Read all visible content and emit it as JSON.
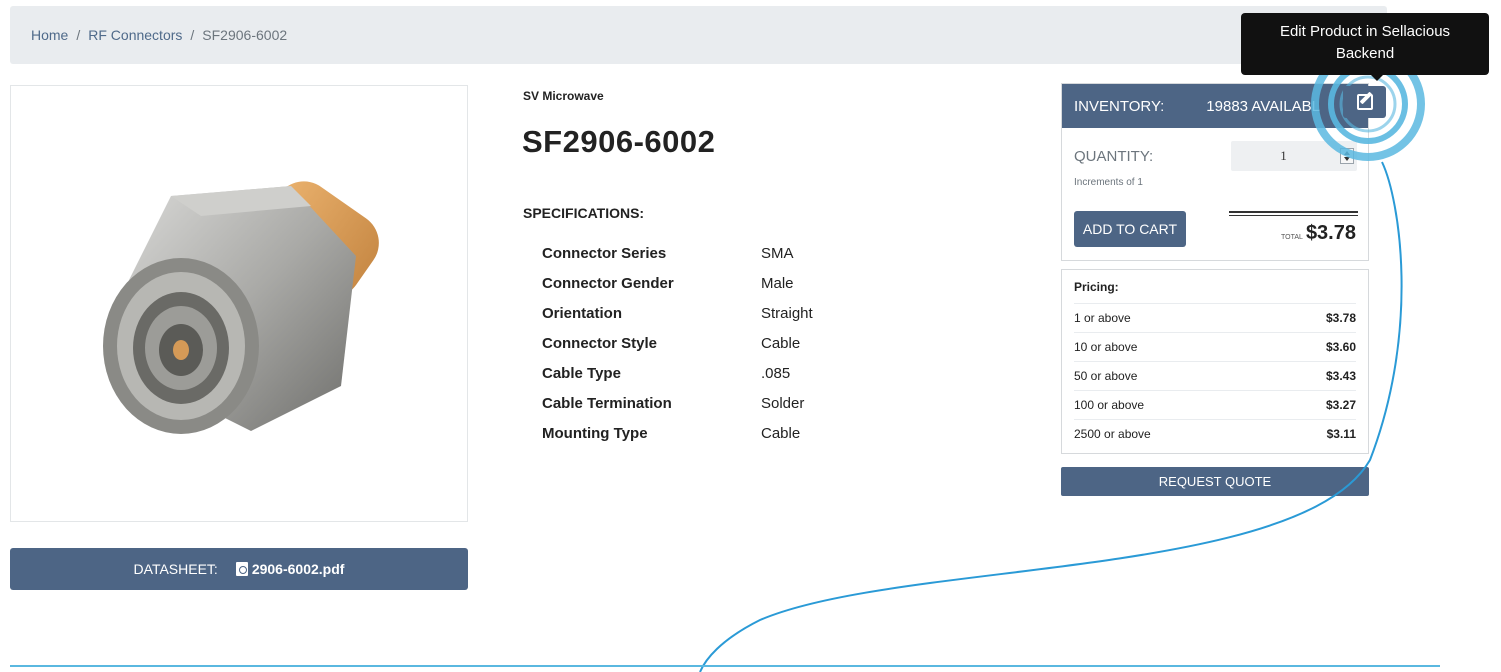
{
  "breadcrumb": {
    "home": "Home",
    "category": "RF Connectors",
    "current": "SF2906-6002",
    "separator": "/"
  },
  "product": {
    "brand": "SV Microwave",
    "title": "SF2906-6002",
    "spec_heading": "SPECIFICATIONS:",
    "specs": [
      {
        "key": "Connector Series",
        "value": "SMA"
      },
      {
        "key": "Connector Gender",
        "value": "Male"
      },
      {
        "key": "Orientation",
        "value": "Straight"
      },
      {
        "key": "Connector Style",
        "value": "Cable"
      },
      {
        "key": "Cable Type",
        "value": ".085"
      },
      {
        "key": "Cable Termination",
        "value": "Solder"
      },
      {
        "key": "Mounting Type",
        "value": "Cable"
      }
    ]
  },
  "datasheet": {
    "label": "DATASHEET:",
    "file": "2906-6002.pdf",
    "icon": "pdf-icon"
  },
  "inventory": {
    "label": "INVENTORY:",
    "available": "19883 AVAILABL",
    "quantity_label": "QUANTITY:",
    "increments": "Increments of 1",
    "quantity_value": "1",
    "add_to_cart": "ADD TO CART",
    "total_label": "TOTAL",
    "total_value": "$3.78"
  },
  "pricing": {
    "heading": "Pricing:",
    "tiers": [
      {
        "qty": "1 or above",
        "price": "$3.78"
      },
      {
        "qty": "10 or above",
        "price": "$3.60"
      },
      {
        "qty": "50 or above",
        "price": "$3.43"
      },
      {
        "qty": "100 or above",
        "price": "$3.27"
      },
      {
        "qty": "2500 or above",
        "price": "$3.11"
      }
    ]
  },
  "request_quote": "REQUEST QUOTE",
  "edit": {
    "tooltip_line1": "Edit Product in Sellacious",
    "tooltip_line2": "Backend",
    "icon": "edit-icon"
  },
  "colors": {
    "primary": "#4d6585",
    "highlight_ring": "#5ab8e0",
    "tooltip_bg": "#111111",
    "breadcrumb_bg": "#e9ecef"
  }
}
